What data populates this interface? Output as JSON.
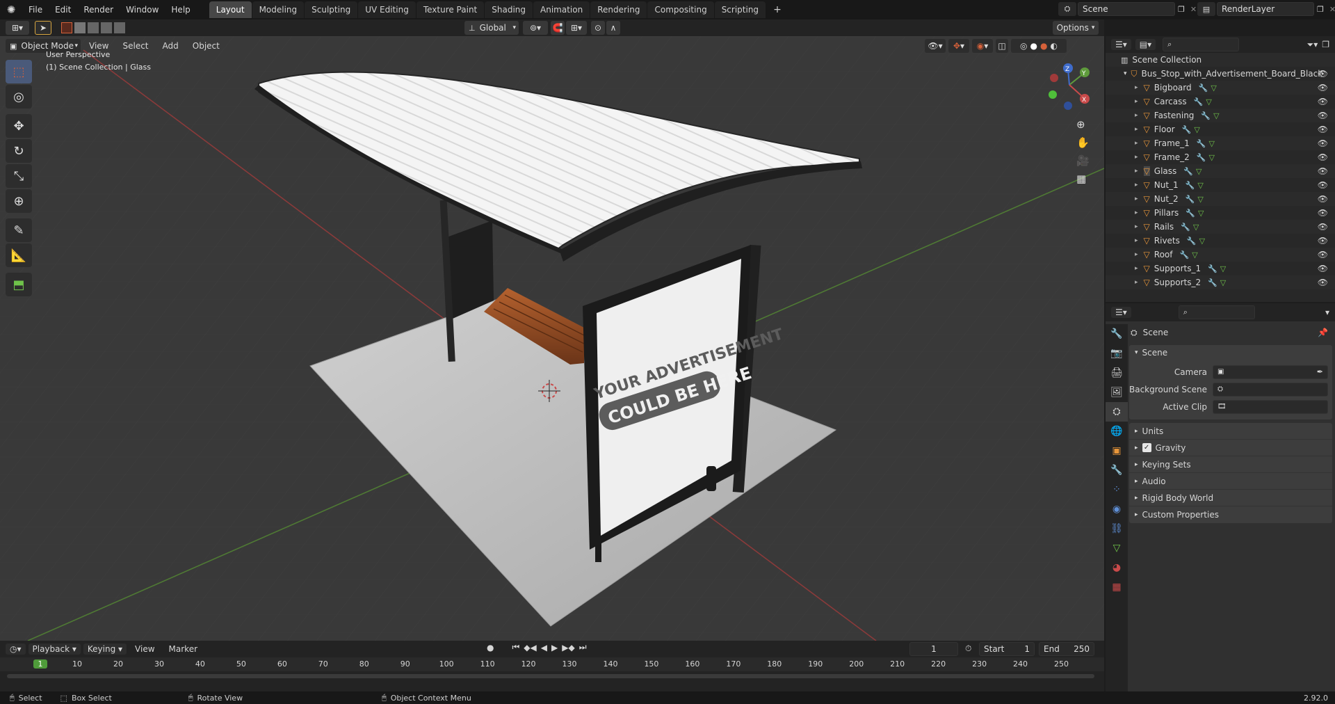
{
  "menubar": {
    "items": [
      "File",
      "Edit",
      "Render",
      "Window",
      "Help"
    ],
    "workspaces": [
      "Layout",
      "Modeling",
      "Sculpting",
      "UV Editing",
      "Texture Paint",
      "Shading",
      "Animation",
      "Rendering",
      "Compositing",
      "Scripting"
    ],
    "active_workspace": "Layout",
    "add_tab": "+",
    "scene_name": "Scene",
    "view_layer": "RenderLayer"
  },
  "viewport_header": {
    "mode": "Object Mode",
    "menus": [
      "View",
      "Select",
      "Add",
      "Object"
    ],
    "transform_orientation": "Global",
    "options": "Options"
  },
  "viewport": {
    "perspective": "User Perspective",
    "collection_info": "(1) Scene Collection | Glass",
    "billboard_text_line1": "YOUR ADVERTISEMENT",
    "billboard_text_line2": "COULD BE HERE",
    "gizmo_labels": {
      "x": "X",
      "y": "Y",
      "z": "Z"
    }
  },
  "outliner": {
    "root": "Scene Collection",
    "collection": "Bus_Stop_with_Advertisement_Board_Black",
    "objects": [
      "Bigboard",
      "Carcass",
      "Fastening",
      "Floor",
      "Frame_1",
      "Frame_2",
      "Glass",
      "Nut_1",
      "Nut_2",
      "Pillars",
      "Rails",
      "Rivets",
      "Roof",
      "Supports_1",
      "Supports_2"
    ],
    "selected": "Glass"
  },
  "properties": {
    "context": "Scene",
    "panel": "Scene",
    "fields": [
      {
        "label": "Camera",
        "value": ""
      },
      {
        "label": "Background Scene",
        "value": ""
      },
      {
        "label": "Active Clip",
        "value": ""
      }
    ],
    "sections": [
      "Units",
      "Gravity",
      "Keying Sets",
      "Audio",
      "Rigid Body World",
      "Custom Properties"
    ],
    "gravity_checked": true
  },
  "timeline": {
    "menus": [
      "Playback",
      "Keying",
      "View",
      "Marker"
    ],
    "current_frame": "1",
    "start_label": "Start",
    "start": "1",
    "end_label": "End",
    "end": "250",
    "ruler": [
      "1",
      "10",
      "20",
      "30",
      "40",
      "50",
      "60",
      "70",
      "80",
      "90",
      "100",
      "110",
      "120",
      "130",
      "140",
      "150",
      "160",
      "170",
      "180",
      "190",
      "200",
      "210",
      "220",
      "230",
      "240",
      "250"
    ]
  },
  "statusbar": {
    "select": "Select",
    "box_select": "Box Select",
    "rotate_view": "Rotate View",
    "context_menu": "Object Context Menu",
    "version": "2.92.0"
  },
  "colors": {
    "object_icon": "#e8963a",
    "axis_x": "#c94a4a",
    "axis_y": "#5f9c3c",
    "axis_z": "#3f6ccc",
    "accent": "#4a5a7a"
  }
}
